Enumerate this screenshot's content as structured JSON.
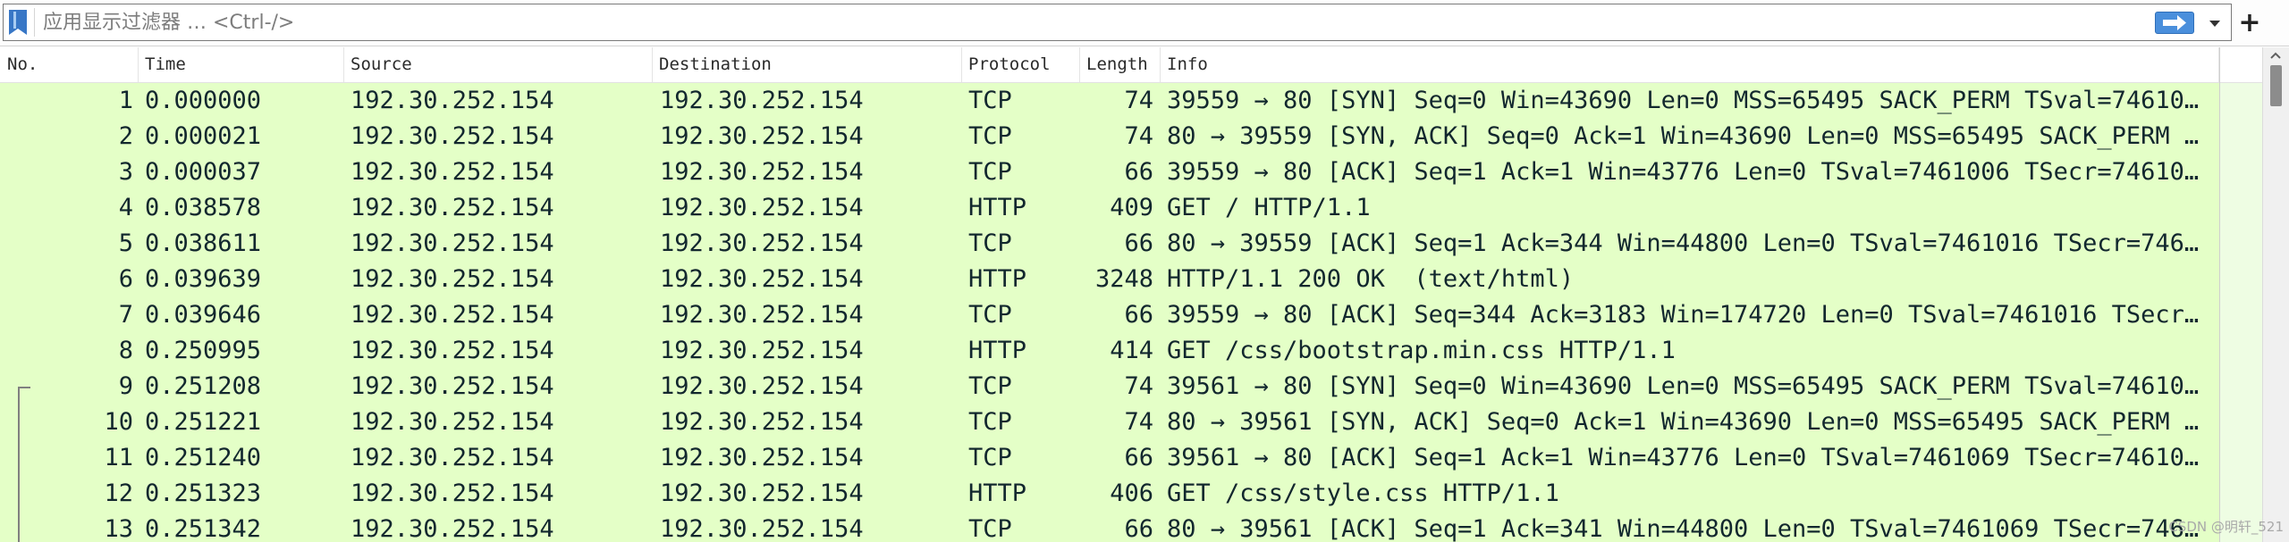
{
  "filter_bar": {
    "placeholder": "应用显示过滤器 … <Ctrl-/>",
    "value": "",
    "add_button_label": "+",
    "icons": {
      "bookmark": "bookmark-icon",
      "apply": "arrow-right-icon",
      "history": "chevron-down-icon"
    }
  },
  "packet_list": {
    "columns": [
      "No.",
      "Time",
      "Source",
      "Destination",
      "Protocol",
      "Length",
      "Info"
    ],
    "related_packets_from_no": 9,
    "rows": [
      {
        "no": 1,
        "time": "0.000000",
        "source": "192.30.252.154",
        "destination": "192.30.252.154",
        "protocol": "TCP",
        "length": 74,
        "info": "39559 → 80 [SYN] Seq=0 Win=43690 Len=0 MSS=65495 SACK_PERM TSval=74610…"
      },
      {
        "no": 2,
        "time": "0.000021",
        "source": "192.30.252.154",
        "destination": "192.30.252.154",
        "protocol": "TCP",
        "length": 74,
        "info": "80 → 39559 [SYN, ACK] Seq=0 Ack=1 Win=43690 Len=0 MSS=65495 SACK_PERM …"
      },
      {
        "no": 3,
        "time": "0.000037",
        "source": "192.30.252.154",
        "destination": "192.30.252.154",
        "protocol": "TCP",
        "length": 66,
        "info": "39559 → 80 [ACK] Seq=1 Ack=1 Win=43776 Len=0 TSval=7461006 TSecr=74610…"
      },
      {
        "no": 4,
        "time": "0.038578",
        "source": "192.30.252.154",
        "destination": "192.30.252.154",
        "protocol": "HTTP",
        "length": 409,
        "info": "GET / HTTP/1.1"
      },
      {
        "no": 5,
        "time": "0.038611",
        "source": "192.30.252.154",
        "destination": "192.30.252.154",
        "protocol": "TCP",
        "length": 66,
        "info": "80 → 39559 [ACK] Seq=1 Ack=344 Win=44800 Len=0 TSval=7461016 TSecr=746…"
      },
      {
        "no": 6,
        "time": "0.039639",
        "source": "192.30.252.154",
        "destination": "192.30.252.154",
        "protocol": "HTTP",
        "length": 3248,
        "info": "HTTP/1.1 200 OK  (text/html)"
      },
      {
        "no": 7,
        "time": "0.039646",
        "source": "192.30.252.154",
        "destination": "192.30.252.154",
        "protocol": "TCP",
        "length": 66,
        "info": "39559 → 80 [ACK] Seq=344 Ack=3183 Win=174720 Len=0 TSval=7461016 TSecr…"
      },
      {
        "no": 8,
        "time": "0.250995",
        "source": "192.30.252.154",
        "destination": "192.30.252.154",
        "protocol": "HTTP",
        "length": 414,
        "info": "GET /css/bootstrap.min.css HTTP/1.1"
      },
      {
        "no": 9,
        "time": "0.251208",
        "source": "192.30.252.154",
        "destination": "192.30.252.154",
        "protocol": "TCP",
        "length": 74,
        "info": "39561 → 80 [SYN] Seq=0 Win=43690 Len=0 MSS=65495 SACK_PERM TSval=74610…"
      },
      {
        "no": 10,
        "time": "0.251221",
        "source": "192.30.252.154",
        "destination": "192.30.252.154",
        "protocol": "TCP",
        "length": 74,
        "info": "80 → 39561 [SYN, ACK] Seq=0 Ack=1 Win=43690 Len=0 MSS=65495 SACK_PERM …"
      },
      {
        "no": 11,
        "time": "0.251240",
        "source": "192.30.252.154",
        "destination": "192.30.252.154",
        "protocol": "TCP",
        "length": 66,
        "info": "39561 → 80 [ACK] Seq=1 Ack=1 Win=43776 Len=0 TSval=7461069 TSecr=74610…"
      },
      {
        "no": 12,
        "time": "0.251323",
        "source": "192.30.252.154",
        "destination": "192.30.252.154",
        "protocol": "HTTP",
        "length": 406,
        "info": "GET /css/style.css HTTP/1.1"
      },
      {
        "no": 13,
        "time": "0.251342",
        "source": "192.30.252.154",
        "destination": "192.30.252.154",
        "protocol": "TCP",
        "length": 66,
        "info": "80 → 39561 [ACK] Seq=1 Ack=341 Win=44800 Len=0 TSval=7461069 TSecr=746…"
      }
    ]
  },
  "scrollbar": {
    "position": 0,
    "icons": {
      "up": "chevron-up-icon"
    }
  },
  "colors": {
    "row_background": "#e4ffc7",
    "row_text": "#12272e",
    "apply_button": "#4a8fdc",
    "bookmark": "#3877c6"
  },
  "watermark": "CSDN @明轩_521"
}
